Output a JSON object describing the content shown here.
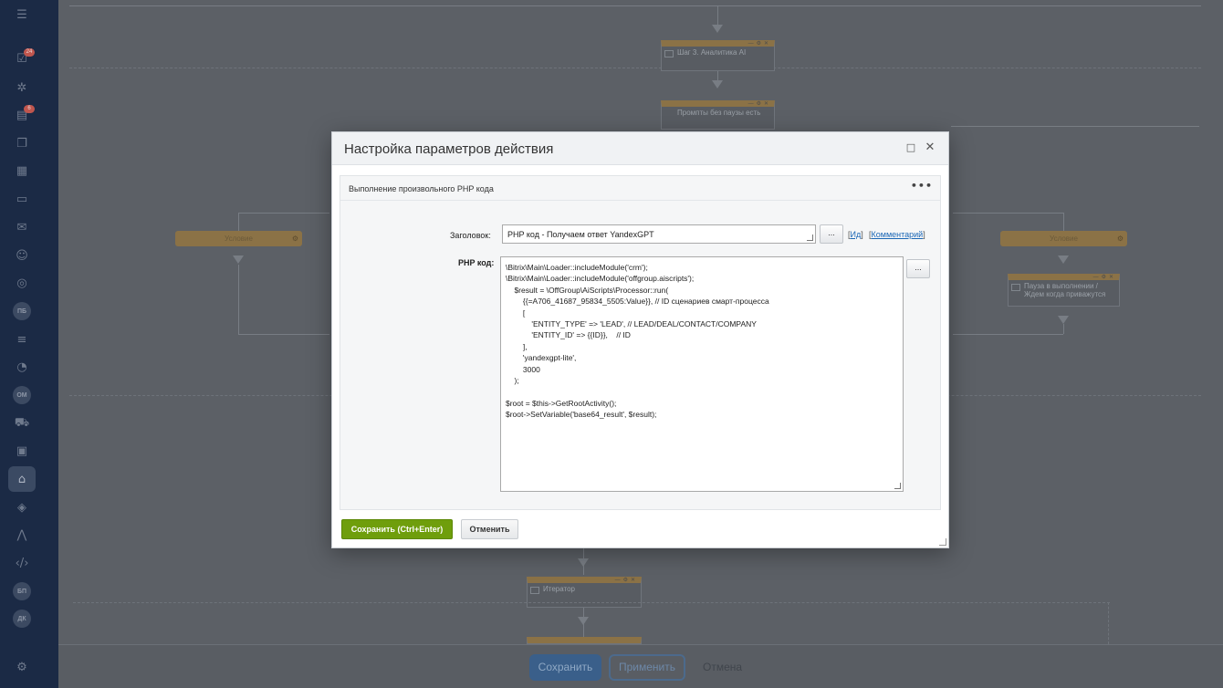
{
  "canvas": {
    "blocks": [
      {
        "label": "Шаг 3. Аналитика AI"
      },
      {
        "label": "Промпты без паузы есть"
      },
      {
        "label": "Пауза в выполнении / Ждем когда приважутся"
      },
      {
        "label": "Итератор"
      }
    ],
    "conditions": [
      "Условие",
      "Условие"
    ]
  },
  "sidebar": {
    "badges": [
      "24",
      "6"
    ],
    "icons": [
      "menu-icon",
      "tasks-icon",
      "settings-icon",
      "feed-icon",
      "chat-icon",
      "calendar-icon",
      "drive-icon",
      "mail-icon",
      "contacts-icon",
      "sites-icon",
      "ПБ",
      "filter-icon",
      "analytics-icon",
      "ОМ",
      "shop-icon",
      "crm-icon",
      "automation-icon",
      "marketplace-icon",
      "bi-icon",
      "code-icon",
      "БП",
      "ДК",
      "settings-icon"
    ]
  },
  "bottom_bar": {
    "save": "Сохранить",
    "apply": "Применить",
    "cancel": "Отмена"
  },
  "modal": {
    "title": "Настройка параметров действия",
    "activity_type": "Выполнение произвольного PHP кода",
    "title_label": "Заголовок:",
    "title_value": "PHP код - Получаем ответ YandexGPT",
    "dots": "...",
    "id_link": "Ид",
    "comment_link": "Комментарий",
    "code_label": "PHP код:",
    "code": "\\Bitrix\\Main\\Loader::includeModule('crm');\n\\Bitrix\\Main\\Loader::includeModule('offgroup.aiscripts');\n    $result = \\OffGroup\\AiScripts\\Processor::run(\n        {{=A706_41687_95834_5505:Value}}, // ID сценариев смарт-процесса\n        [\n            'ENTITY_TYPE' => 'LEAD', // LEAD/DEAL/CONTACT/COMPANY\n            'ENTITY_ID' => {{ID}},    // ID\n        ],\n        'yandexgpt-lite',\n        3000\n    );\n\n$root = $this->GetRootActivity();\n$root->SetVariable('base64_result', $result);",
    "save_button": "Сохранить (Ctrl+Enter)",
    "cancel_button": "Отменить"
  }
}
